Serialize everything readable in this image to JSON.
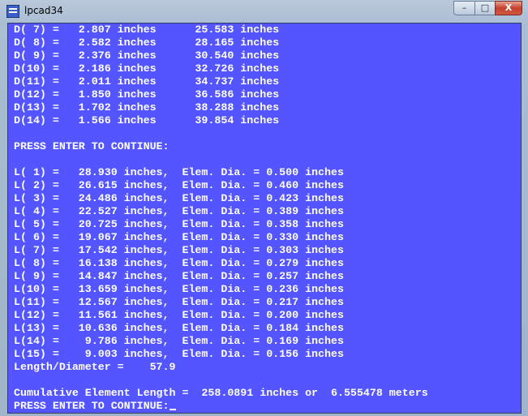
{
  "window": {
    "title": "lpcad34",
    "minimize_label": "–",
    "maximize_label": "□",
    "close_label": "X",
    "background_color": "#5555ff",
    "text_color": "#ffffff"
  },
  "console": {
    "lines": [
      "D( 7) =   2.807 inches      25.583 inches",
      "D( 8) =   2.582 inches      28.165 inches",
      "D( 9) =   2.376 inches      30.540 inches",
      "D(10) =   2.186 inches      32.726 inches",
      "D(11) =   2.011 inches      34.737 inches",
      "D(12) =   1.850 inches      36.586 inches",
      "D(13) =   1.702 inches      38.288 inches",
      "D(14) =   1.566 inches      39.854 inches",
      "",
      "PRESS ENTER TO CONTINUE:",
      "",
      "L( 1) =   28.930 inches,  Elem. Dia. = 0.500 inches",
      "L( 2) =   26.615 inches,  Elem. Dia. = 0.460 inches",
      "L( 3) =   24.486 inches,  Elem. Dia. = 0.423 inches",
      "L( 4) =   22.527 inches,  Elem. Dia. = 0.389 inches",
      "L( 5) =   20.725 inches,  Elem. Dia. = 0.358 inches",
      "L( 6) =   19.067 inches,  Elem. Dia. = 0.330 inches",
      "L( 7) =   17.542 inches,  Elem. Dia. = 0.303 inches",
      "L( 8) =   16.138 inches,  Elem. Dia. = 0.279 inches",
      "L( 9) =   14.847 inches,  Elem. Dia. = 0.257 inches",
      "L(10) =   13.659 inches,  Elem. Dia. = 0.236 inches",
      "L(11) =   12.567 inches,  Elem. Dia. = 0.217 inches",
      "L(12) =   11.561 inches,  Elem. Dia. = 0.200 inches",
      "L(13) =   10.636 inches,  Elem. Dia. = 0.184 inches",
      "L(14) =    9.786 inches,  Elem. Dia. = 0.169 inches",
      "L(15) =    9.003 inches,  Elem. Dia. = 0.156 inches",
      "Length/Diameter =    57.9",
      "",
      "Cumulative Element Length =  258.0891 inches or  6.555478 meters"
    ],
    "prompt": "PRESS ENTER TO CONTINUE:"
  }
}
